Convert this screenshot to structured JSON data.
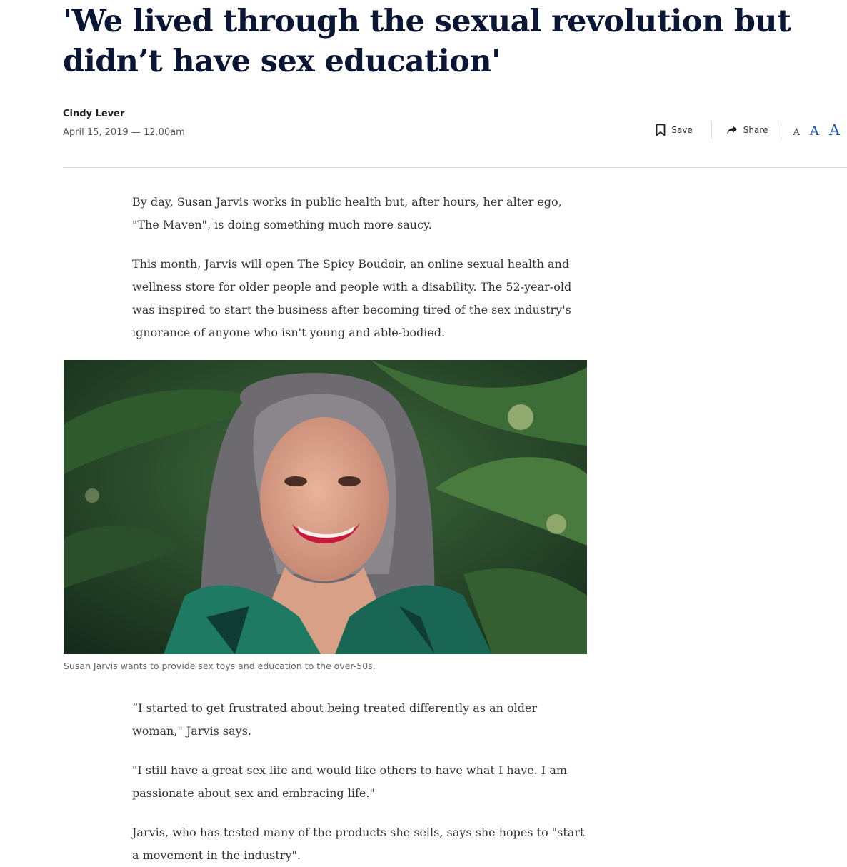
{
  "article": {
    "headline": "'We lived through the sexual revolution but didn’t have sex education'",
    "author": "Cindy Lever",
    "date": "April 15, 2019 — 12.00am"
  },
  "toolbar": {
    "save_label": "Save",
    "share_label": "Share",
    "font_sizes": [
      "A",
      "A",
      "A"
    ],
    "accent_color": "#1a56b8"
  },
  "body": {
    "paragraphs_top": [
      "By day, Susan Jarvis works in public health but, after hours, her alter ego, \"The Maven\", is doing something much more saucy.",
      "This month, Jarvis will open The Spicy Boudoir, an online sexual health and wellness store for older people and people with a disability. The 52-year-old was inspired to start the business after becoming tired of the sex industry's ignorance of anyone who isn't young and able-bodied."
    ],
    "image_caption": "Susan Jarvis wants to provide sex toys and education to the over-50s.",
    "paragraphs_bottom": [
      "“I started to get frustrated about being treated differently as an older woman,\" Jarvis says.",
      "\"I still have a great sex life and would like others to have what I have. I am passionate about sex and embracing life.\"",
      "Jarvis, who has tested many of the products she sells, says she hopes to \"start a movement in the industry\"."
    ]
  }
}
